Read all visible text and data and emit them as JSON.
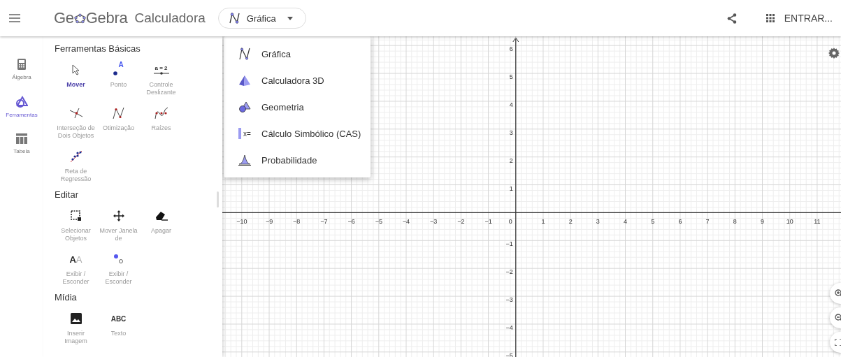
{
  "header": {
    "logo": [
      "Ge",
      "Gebra"
    ],
    "app_name": "Calculadora",
    "app_switcher": {
      "label": "Gráfica"
    },
    "login": "ENTRAR..."
  },
  "rail": [
    {
      "label": "Álgebra",
      "kind": "calculator",
      "selected": false
    },
    {
      "label": "Ferramentas",
      "kind": "tools",
      "selected": true
    },
    {
      "label": "Tabela",
      "kind": "table",
      "selected": false
    }
  ],
  "tool_sections": [
    {
      "title": "Ferramentas Básicas",
      "tools": [
        {
          "label": "Mover",
          "kind": "move",
          "selected": true
        },
        {
          "label": "Ponto",
          "kind": "point",
          "icon_text": "A",
          "selected": false
        },
        {
          "label": "Controle Deslizante",
          "kind": "slider",
          "icon_text": "a = 2",
          "selected": false
        },
        {
          "label": "Interseção de Dois Objetos",
          "kind": "intersect",
          "selected": false
        },
        {
          "label": "Otimização",
          "kind": "extremum",
          "selected": false
        },
        {
          "label": "Raízes",
          "kind": "roots",
          "selected": false
        },
        {
          "label": "Reta de Regressão",
          "kind": "regression",
          "selected": false
        }
      ]
    },
    {
      "title": "Editar",
      "tools": [
        {
          "label": "Selecionar Objetos",
          "kind": "select",
          "selected": false
        },
        {
          "label": "Mover Janela de",
          "kind": "pan",
          "selected": false
        },
        {
          "label": "Apagar",
          "kind": "eraser",
          "selected": false
        },
        {
          "label": "Exibir / Esconder",
          "kind": "label",
          "icon_text": "**A**A",
          "selected": false
        },
        {
          "label": "Exibir / Esconder",
          "kind": "showhide",
          "selected": false
        }
      ]
    },
    {
      "title": "Mídia",
      "tools": [
        {
          "label": "Inserir Imagem",
          "kind": "image",
          "selected": false
        },
        {
          "label": "Texto",
          "kind": "text",
          "icon_text": "ABC",
          "selected": false
        }
      ]
    }
  ],
  "app_menu": [
    {
      "label": "Gráfica",
      "kind": "graphing"
    },
    {
      "label": "Calculadora 3D",
      "kind": "solid"
    },
    {
      "label": "Geometria",
      "kind": "geometry"
    },
    {
      "label": "Cálculo Simbólico (CAS)",
      "kind": "cas",
      "icon_text": "x="
    },
    {
      "label": "Probabilidade",
      "kind": "probability"
    }
  ],
  "graphics_view": {
    "origin_label": "0",
    "chart_data": {
      "type": "line",
      "xlim": [
        -10.71,
        11.87
      ],
      "ylim": [
        -5.18,
        6.33
      ],
      "grid": true,
      "xticks": [
        {
          "value": -10,
          "label": "−10"
        },
        {
          "value": -9,
          "label": "−9"
        },
        {
          "value": -8,
          "label": "−8"
        },
        {
          "value": -7,
          "label": "−7"
        },
        {
          "value": -6,
          "label": "−6"
        },
        {
          "value": -5,
          "label": "−5"
        },
        {
          "value": -4,
          "label": "−4"
        },
        {
          "value": -3,
          "label": "−3"
        },
        {
          "value": -2,
          "label": "−2"
        },
        {
          "value": -1,
          "label": "−1"
        },
        {
          "value": 1,
          "label": "1"
        },
        {
          "value": 2,
          "label": "2"
        },
        {
          "value": 3,
          "label": "3"
        },
        {
          "value": 4,
          "label": "4"
        },
        {
          "value": 5,
          "label": "5"
        },
        {
          "value": 6,
          "label": "6"
        },
        {
          "value": 7,
          "label": "7"
        },
        {
          "value": 8,
          "label": "8"
        },
        {
          "value": 9,
          "label": "9"
        },
        {
          "value": 10,
          "label": "10"
        },
        {
          "value": 11,
          "label": "11"
        }
      ],
      "yticks": [
        {
          "value": -5,
          "label": "−5"
        },
        {
          "value": -4,
          "label": "−4"
        },
        {
          "value": -3,
          "label": "−3"
        },
        {
          "value": -2,
          "label": "−2"
        },
        {
          "value": -1,
          "label": "−1"
        },
        {
          "value": 1,
          "label": "1"
        },
        {
          "value": 2,
          "label": "2"
        },
        {
          "value": 3,
          "label": "3"
        },
        {
          "value": 4,
          "label": "4"
        },
        {
          "value": 5,
          "label": "5"
        },
        {
          "value": 6,
          "label": "6"
        }
      ]
    }
  }
}
